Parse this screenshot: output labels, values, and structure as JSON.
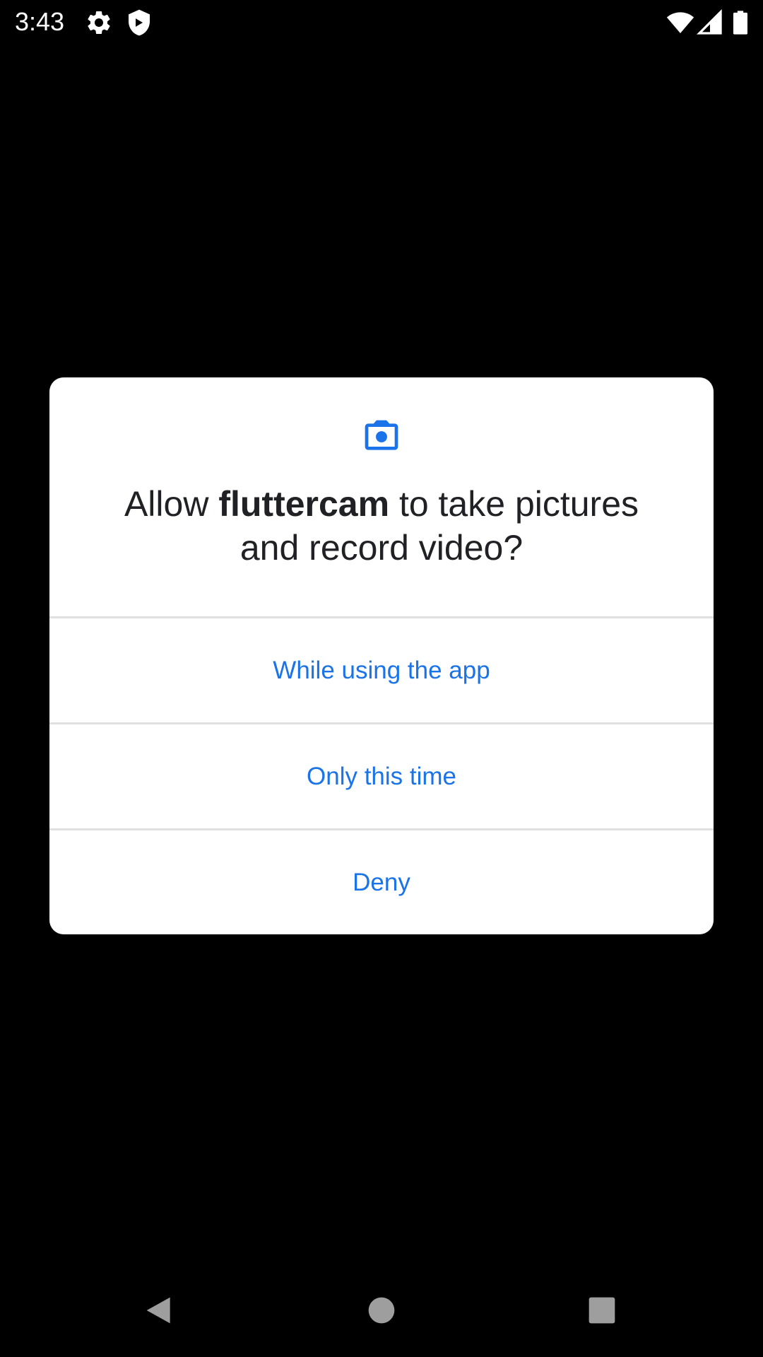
{
  "status_bar": {
    "time": "3:43",
    "icons": [
      "gear-icon",
      "shield-icon",
      "wifi-icon",
      "cell-signal-icon",
      "battery-icon"
    ]
  },
  "dialog": {
    "icon": "camera-icon",
    "title_prefix": "Allow ",
    "app_name": "fluttercam",
    "title_suffix": " to take pictures and record video?",
    "options": [
      {
        "label": "While using the app"
      },
      {
        "label": "Only this time"
      },
      {
        "label": "Deny"
      }
    ]
  },
  "nav_bar": {
    "buttons": [
      "back-icon",
      "home-icon",
      "recents-icon"
    ]
  },
  "colors": {
    "background": "#000000",
    "dialog_bg": "#ffffff",
    "accent": "#1a73e8",
    "title_text": "#202124",
    "divider": "#e0e0e0",
    "nav_icon": "#9e9e9e"
  }
}
